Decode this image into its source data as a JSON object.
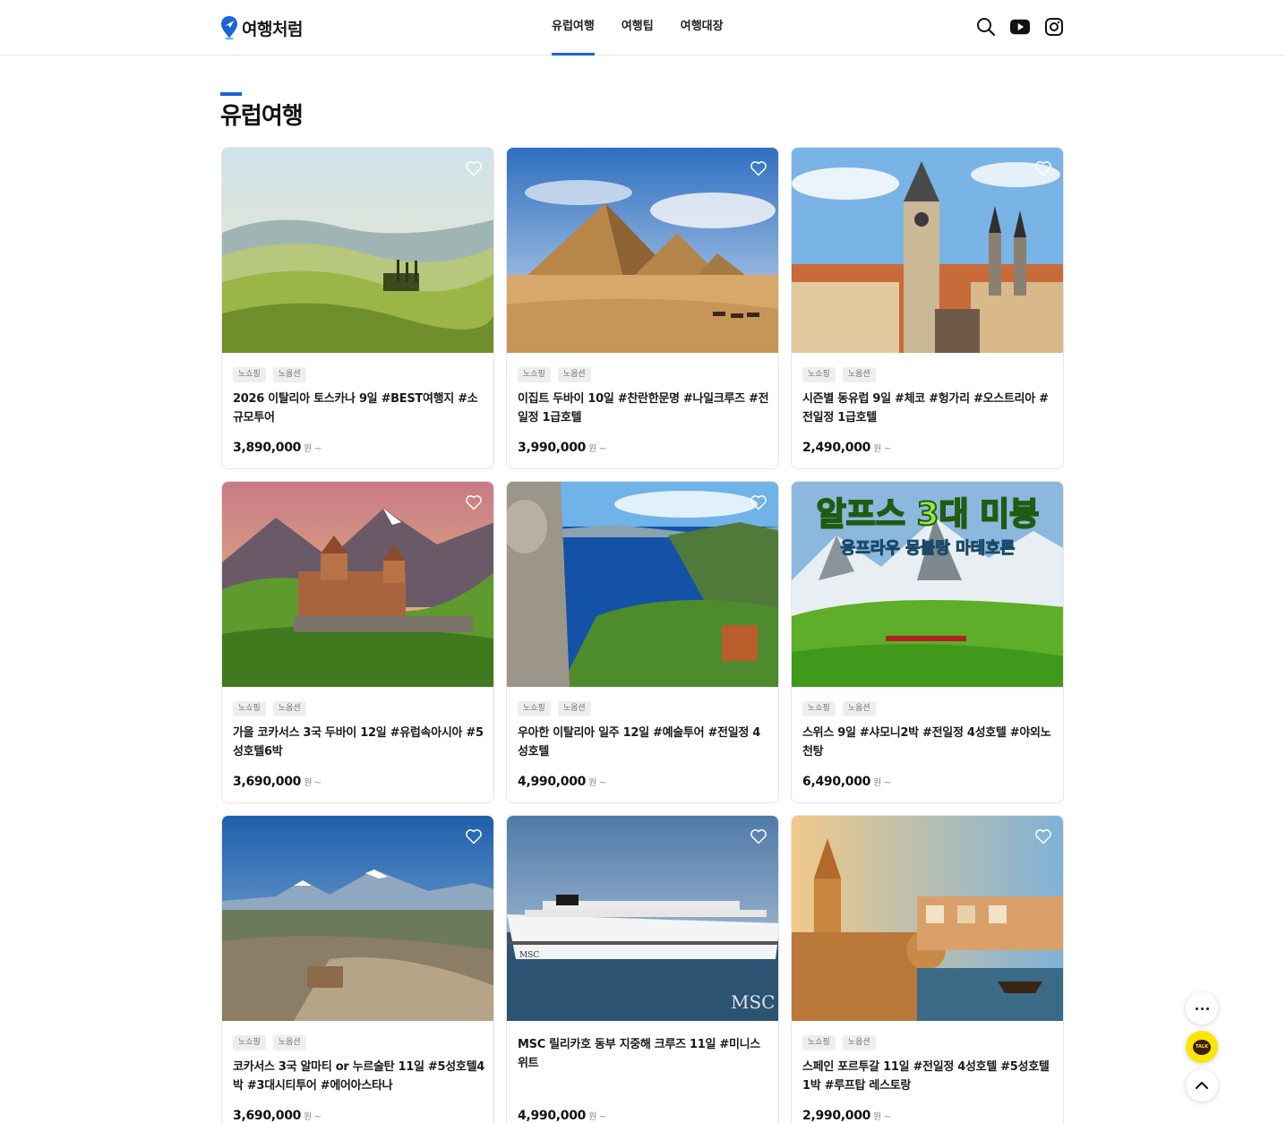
{
  "header": {
    "logo_text": "여행처럼",
    "nav": [
      {
        "label": "유럽여행",
        "active": true
      },
      {
        "label": "여행팁",
        "active": false
      },
      {
        "label": "여행대장",
        "active": false
      }
    ],
    "icons": [
      "search-icon",
      "youtube-icon",
      "instagram-icon"
    ]
  },
  "section": {
    "title": "유럽여행"
  },
  "colors": {
    "accent": "#1a64d8"
  },
  "cards": [
    {
      "tags": [
        "노쇼핑",
        "노옵션"
      ],
      "title": "2026 이탈리아 토스카나 9일 #BEST여행지 #소규모투어",
      "price": "3,890,000",
      "unit": "원 ~"
    },
    {
      "tags": [
        "노쇼핑",
        "노옵션"
      ],
      "title": "이집트 두바이 10일 #찬란한문명 #나일크루즈 #전일정 1급호텔",
      "price": "3,990,000",
      "unit": "원 ~"
    },
    {
      "tags": [
        "노쇼핑",
        "노옵션"
      ],
      "title": "시즌별 동유럽 9일 #체코 #헝가리 #오스트리아 #전일정 1급호텔",
      "price": "2,490,000",
      "unit": "원 ~"
    },
    {
      "tags": [
        "노쇼핑",
        "노옵션"
      ],
      "title": "가을 코카서스 3국 두바이 12일 #유럽속아시아 #5성호텔6박",
      "price": "3,690,000",
      "unit": "원 ~"
    },
    {
      "tags": [
        "노쇼핑",
        "노옵션"
      ],
      "title": "우아한 이탈리아 일주 12일 #예술투어 #전일정 4성호텔",
      "price": "4,990,000",
      "unit": "원 ~"
    },
    {
      "tags": [
        "노쇼핑",
        "노옵션"
      ],
      "title": "스위스 9일 #샤모니2박 #전일정 4성호텔 #야외노천탕",
      "price": "6,490,000",
      "unit": "원 ~",
      "overlay_title": "알프스 3대 미봉",
      "overlay_sub": "융프라우 몽블랑 마테호른"
    },
    {
      "tags": [
        "노쇼핑",
        "노옵션"
      ],
      "title": "코카서스 3국 알마티 or 누르술탄 11일 #5성호텔4박 #3대시티투어 #에어아스타나",
      "price": "3,690,000",
      "unit": "원 ~"
    },
    {
      "tags": [],
      "title": "MSC 릴리카호 동부 지중해 크루즈 11일 #미니스위트",
      "price": "4,990,000",
      "unit": "원 ~",
      "brand_small": "MSC",
      "brand_large": "MSC"
    },
    {
      "tags": [
        "노쇼핑",
        "노옵션"
      ],
      "title": "스페인 포르투갈 11일 #전일정 4성호텔 #5성호텔1박 #루프탑 레스토랑",
      "price": "2,990,000",
      "unit": "원 ~"
    }
  ],
  "floating": {
    "talk_label": "TALK"
  }
}
